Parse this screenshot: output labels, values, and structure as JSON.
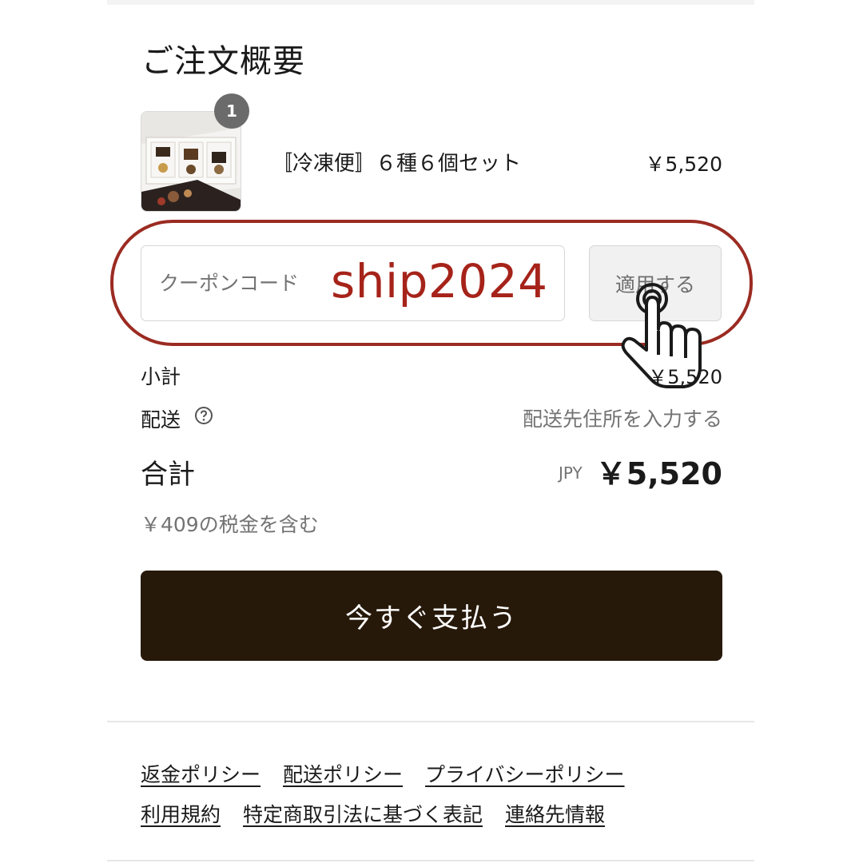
{
  "order_summary": {
    "title": "ご注文概要",
    "product": {
      "quantity_badge": "1",
      "name": "〚冷凍便〛６種６個セット",
      "price": "￥5,520",
      "image_icon": "product-box-image"
    },
    "coupon": {
      "placeholder": "クーポンコード",
      "entered_code": "ship2024",
      "apply_label": "適用する",
      "highlight_color": "#9b2b22"
    },
    "subtotal": {
      "label": "小計",
      "value": "￥5,520"
    },
    "shipping": {
      "label": "配送",
      "value": "配送先住所を入力する",
      "help_icon": "question-circle-icon"
    },
    "total": {
      "label": "合計",
      "currency": "JPY",
      "value": "￥5,520"
    },
    "tax_note": "￥409の税金を含む",
    "pay_button": {
      "label": "今すぐ支払う",
      "color": "#27190a"
    }
  },
  "footer_links": [
    [
      "返金ポリシー",
      "配送ポリシー",
      "プライバシーポリシー"
    ],
    [
      "利用規約",
      "特定商取引法に基づく表記",
      "連絡先情報"
    ]
  ]
}
